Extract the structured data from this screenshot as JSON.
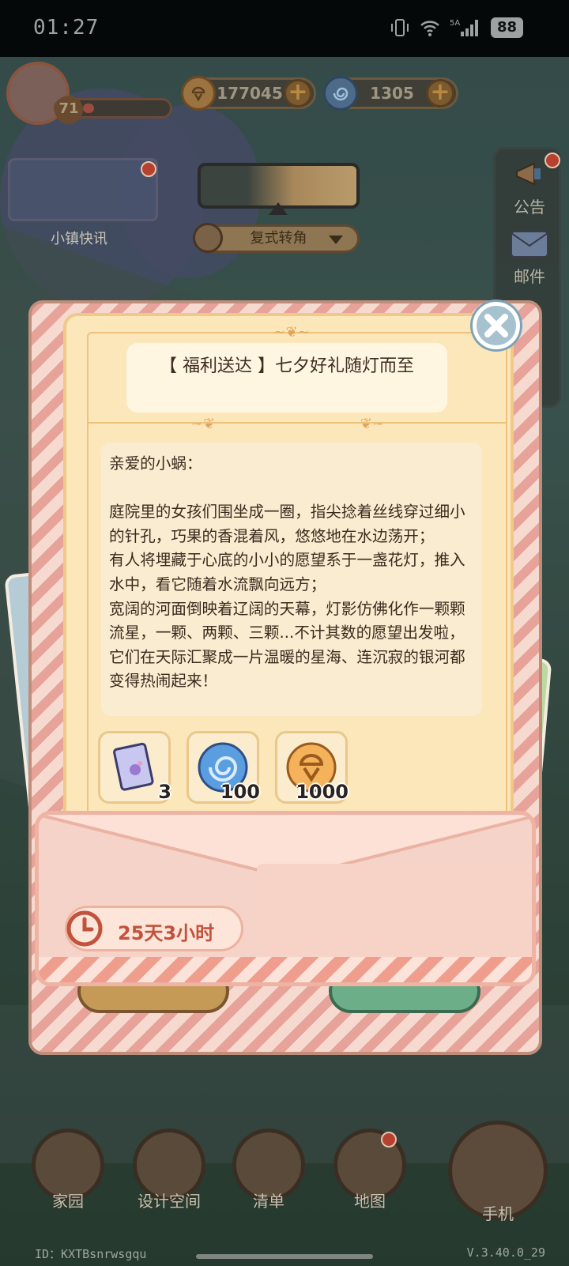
{
  "status_bar": {
    "time": "01:27",
    "network": "5A",
    "battery": "88"
  },
  "hud": {
    "level": "71",
    "coins": "177045",
    "gems": "1305",
    "news_label": "小镇快讯",
    "view_select": "复式转角",
    "side": {
      "notice": "公告",
      "mail": "邮件"
    }
  },
  "mail": {
    "title": "【 福利送达 】七夕好礼随灯而至",
    "greeting": "亲爱的小蜗：",
    "paragraphs": [
      "庭院里的女孩们围坐成一圈，指尖捻着丝线穿过细小的针孔，巧果的香混着风，悠悠地在水边荡开；",
      "有人将埋藏于心底的小小的愿望系于一盏花灯，推入水中，看它随着水流飘向远方；",
      "宽阔的河面倒映着辽阔的天幕，灯影仿佛化作一颗颗流星，一颗、两颗、三颗...不计其数的愿望出发啦，它们在天际汇聚成一片温暖的星海、连沉寂的银河都变得热闹起来！"
    ],
    "rewards": [
      {
        "name": "scroll-item",
        "qty": "3"
      },
      {
        "name": "swirl-gem",
        "qty": "100"
      },
      {
        "name": "coin",
        "qty": "1000"
      }
    ],
    "expires": "25天3小时"
  },
  "nav": {
    "home": "家园",
    "design": "设计空间",
    "list": "清单",
    "map": "地图",
    "phone": "手机"
  },
  "footer": {
    "id": "ID：KXTBsnrwsgqu",
    "version": "V.3.40.0_29"
  },
  "colors": {
    "accent": "#c1533d",
    "paper": "#fbe7b9",
    "frame": "#e7a39a"
  }
}
